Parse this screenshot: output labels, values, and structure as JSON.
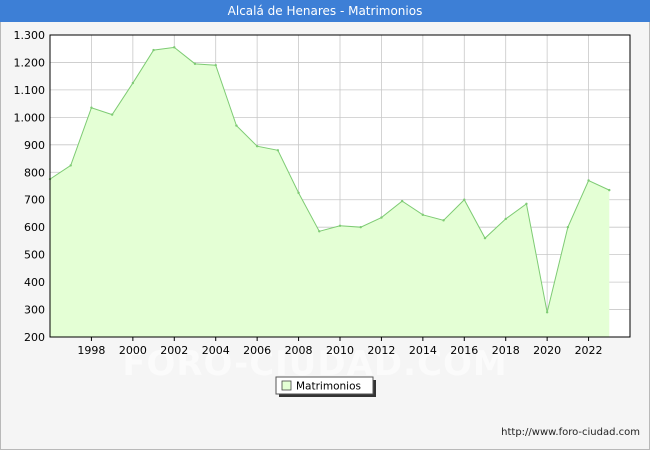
{
  "header": {
    "title": "Alcalá de Henares - Matrimonios"
  },
  "watermark": "FORO-CIUDAD.COM",
  "footer": {
    "url": "http://www.foro-ciudad.com"
  },
  "colors": {
    "title_bg": "#3d7fd6",
    "area_fill": "#e4ffd5",
    "line": "#7ecb74",
    "grid": "#c8c8c8"
  },
  "chart_data": {
    "type": "area",
    "title": "Alcalá de Henares - Matrimonios",
    "xlabel": "",
    "ylabel": "",
    "xlim": [
      1996,
      2024
    ],
    "ylim": [
      200,
      1300
    ],
    "x_ticks": [
      "1998",
      "2000",
      "2002",
      "2004",
      "2006",
      "2008",
      "2010",
      "2012",
      "2014",
      "2016",
      "2018",
      "2020",
      "2022"
    ],
    "y_ticks": [
      "200",
      "300",
      "400",
      "500",
      "600",
      "700",
      "800",
      "900",
      "1.000",
      "1.100",
      "1.200",
      "1.300"
    ],
    "grid": true,
    "legend_position": "bottom-center",
    "series": [
      {
        "name": "Matrimonios",
        "x": [
          1996,
          1997,
          1998,
          1999,
          2000,
          2001,
          2002,
          2003,
          2004,
          2005,
          2006,
          2007,
          2008,
          2009,
          2010,
          2011,
          2012,
          2013,
          2014,
          2015,
          2016,
          2017,
          2018,
          2019,
          2020,
          2021,
          2022,
          2023
        ],
        "values": [
          775,
          825,
          1035,
          1010,
          1125,
          1245,
          1255,
          1195,
          1190,
          970,
          895,
          880,
          725,
          585,
          605,
          600,
          635,
          695,
          645,
          625,
          700,
          560,
          630,
          685,
          290,
          600,
          770,
          735
        ]
      }
    ]
  }
}
